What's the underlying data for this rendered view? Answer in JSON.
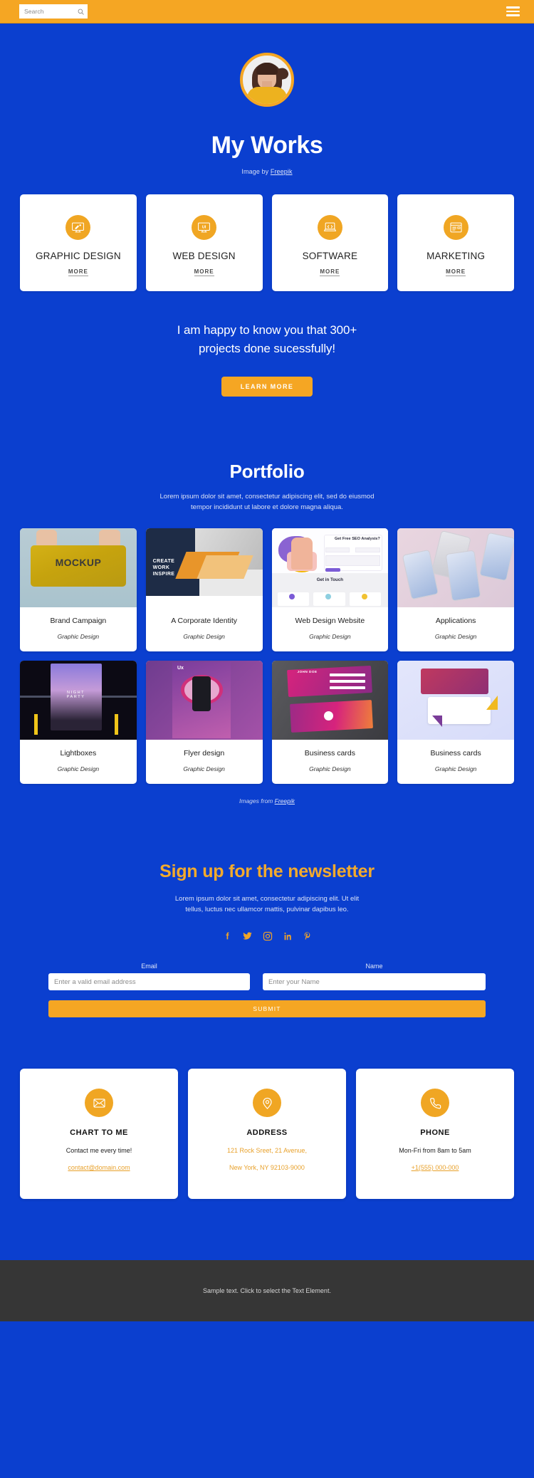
{
  "topbar": {
    "search_placeholder": "Search",
    "search_icon": "search-icon",
    "menu_icon": "hamburger-menu-icon"
  },
  "hero": {
    "title": "My Works",
    "credit_prefix": "Image by ",
    "credit_link": "Freepik",
    "avatar_alt": "profile-photo"
  },
  "services": [
    {
      "icon": "graphic-design-icon",
      "name": "GRAPHIC DESIGN",
      "more": "MORE"
    },
    {
      "icon": "web-design-ui-icon",
      "name": "WEB DESIGN",
      "more": "MORE"
    },
    {
      "icon": "software-code-icon",
      "name": "SOFTWARE",
      "more": "MORE"
    },
    {
      "icon": "marketing-browser-icon",
      "name": "MARKETING",
      "more": "MORE"
    }
  ],
  "happy": {
    "line1": "I am happy to know you that 300+",
    "line2": "projects done sucessfully!",
    "button": "LEARN MORE"
  },
  "portfolio": {
    "title": "Portfolio",
    "subtitle_line1": "Lorem ipsum dolor sit amet, consectetur adipiscing elit, sed do eiusmod",
    "subtitle_line2": "tempor incididunt ut labore et dolore magna aliqua.",
    "items": [
      {
        "title": "Brand Campaign",
        "category": "Graphic Design",
        "thumb": "mockup-bag-photo"
      },
      {
        "title": "A Corporate Identity",
        "category": "Graphic Design",
        "thumb": "corporate-template-photo"
      },
      {
        "title": "Web Design Website",
        "category": "Graphic Design",
        "thumb": "seo-landing-page-photo"
      },
      {
        "title": "Applications",
        "category": "Graphic Design",
        "thumb": "phone-mockups-photo"
      },
      {
        "title": "Lightboxes",
        "category": "Graphic Design",
        "thumb": "night-party-lightbox-photo"
      },
      {
        "title": "Flyer design",
        "category": "Graphic Design",
        "thumb": "purple-flyer-photo"
      },
      {
        "title": "Business cards",
        "category": "Graphic Design",
        "thumb": "pink-business-cards-photo"
      },
      {
        "title": "Business cards",
        "category": "Graphic Design",
        "thumb": "pastel-business-cards-photo"
      }
    ],
    "credit_prefix": "Images from ",
    "credit_link": "Freepik"
  },
  "newsletter": {
    "title": "Sign up for the newsletter",
    "text_line1": "Lorem ipsum dolor sit amet, consectetur adipiscing elit. Ut elit",
    "text_line2": "tellus, luctus nec ullamcor mattis, pulvinar dapibus leo.",
    "socials": [
      {
        "icon": "facebook-icon",
        "name": "Facebook"
      },
      {
        "icon": "twitter-icon",
        "name": "Twitter"
      },
      {
        "icon": "instagram-icon",
        "name": "Instagram"
      },
      {
        "icon": "linkedin-icon",
        "name": "LinkedIn"
      },
      {
        "icon": "pinterest-icon",
        "name": "Pinterest"
      }
    ],
    "email_label": "Email",
    "email_placeholder": "Enter a valid email address",
    "email_value": "",
    "name_label": "Name",
    "name_placeholder": "Enter your Name",
    "name_value": "",
    "submit": "SUBMIT"
  },
  "contacts": [
    {
      "icon": "envelope-icon",
      "title": "CHART TO ME",
      "line1": "Contact me every time!",
      "line2": "contact@domain.com",
      "line1_amber": false,
      "line2_link": true
    },
    {
      "icon": "map-pin-icon",
      "title": "ADDRESS",
      "line1": "121 Rock Sreet, 21 Avenue,",
      "line2": "New York, NY 92103-9000",
      "line1_amber": true,
      "line2_link": false
    },
    {
      "icon": "phone-icon",
      "title": "PHONE",
      "line1": "Mon-Fri from 8am to 5am",
      "line2": "+1(555) 000-000",
      "line1_amber": false,
      "line2_link": true
    }
  ],
  "footer": {
    "text": "Sample text. Click to select the Text Element."
  },
  "colors": {
    "page_bg": "#0b3fcf",
    "accent": "#f5a623",
    "card_bg": "#ffffff",
    "footer_bg": "#363636",
    "newsletter_title": "#f3aa2c"
  }
}
